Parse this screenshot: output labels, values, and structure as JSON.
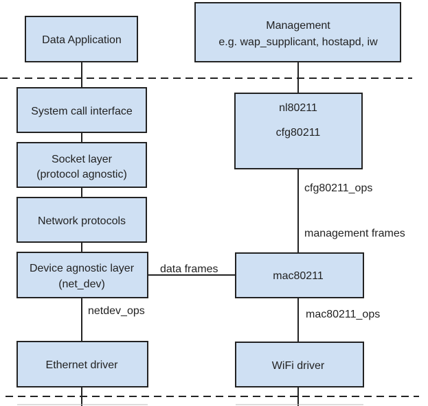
{
  "colors": {
    "box_fill": "#cfe0f3",
    "line": "#222222"
  },
  "user_space": {
    "data_application": "Data Application",
    "management": {
      "title": "Management",
      "subtitle": "e.g. wap_supplicant, hostapd, iw"
    }
  },
  "kernel": {
    "left": [
      "System call interface",
      [
        "Socket layer",
        "(protocol agnostic)"
      ],
      "Network protocols",
      [
        "Device agnostic layer",
        "(net_dev)"
      ],
      "Ethernet driver"
    ],
    "right": {
      "nl80211": "nl80211",
      "cfg80211": "cfg80211",
      "mac80211": "mac80211",
      "wifi_driver": "WiFi driver"
    }
  },
  "edge_labels": {
    "cfg80211_ops": "cfg80211_ops",
    "management_frames": "management frames",
    "data_frames": "data frames",
    "netdev_ops": "netdev_ops",
    "mac80211_ops": "mac80211_ops"
  }
}
